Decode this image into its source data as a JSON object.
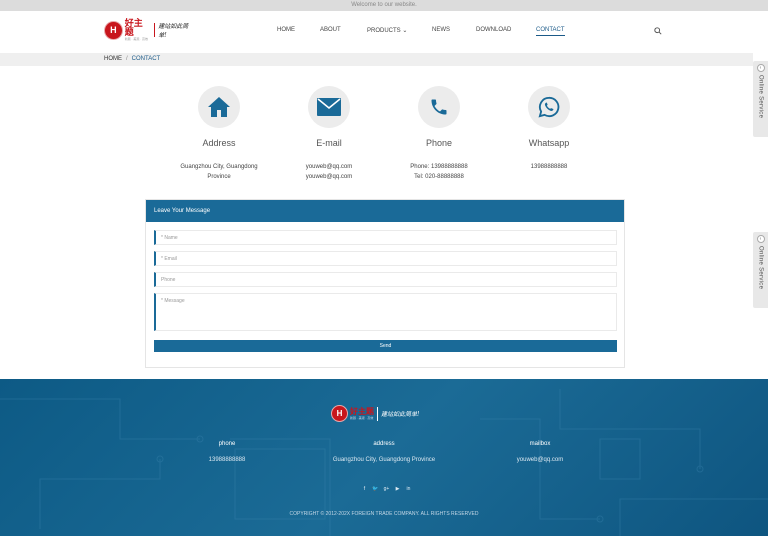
{
  "topbar": {
    "welcome": "Welcome to our website."
  },
  "logo": {
    "mark": "H",
    "brand": "好主题",
    "sub": "新颖 · 美观 · 高效",
    "slogan": "建站如此简单!"
  },
  "nav": {
    "items": [
      {
        "label": "HOME",
        "active": false
      },
      {
        "label": "ABOUT",
        "active": false
      },
      {
        "label": "PRODUCTS",
        "active": false,
        "has_dropdown": true
      },
      {
        "label": "NEWS",
        "active": false
      },
      {
        "label": "DOWNLOAD",
        "active": false
      },
      {
        "label": "CONTACT",
        "active": true
      }
    ],
    "dropdown_glyph": "⌄"
  },
  "breadcrumb": {
    "home": "HOME",
    "separator": "/",
    "current": "CONTACT"
  },
  "cards": [
    {
      "icon": "house-icon",
      "title": "Address",
      "lines": [
        "Guangzhou City, Guangdong",
        "Province"
      ]
    },
    {
      "icon": "envelope-icon",
      "title": "E-mail",
      "lines": [
        "youweb@qq.com",
        "youweb@qq.com"
      ]
    },
    {
      "icon": "phone-icon",
      "title": "Phone",
      "lines": [
        "Phone: 13988888888",
        "Tel: 020-88888888"
      ]
    },
    {
      "icon": "whatsapp-icon",
      "title": "Whatsapp",
      "lines": [
        "13988888888"
      ]
    }
  ],
  "message_form": {
    "title": "Leave Your Message",
    "fields": {
      "name": "* Name",
      "email": "* Email",
      "phone": "Phone",
      "message": "* Message"
    },
    "send_label": "Send"
  },
  "footer": {
    "columns": [
      {
        "label": "phone",
        "value": "13988888888"
      },
      {
        "label": "address",
        "value": "Guangzhou City, Guangdong Province"
      },
      {
        "label": "mailbox",
        "value": "youweb@qq.com"
      }
    ],
    "social": [
      {
        "icon": "facebook-icon",
        "glyph": "f"
      },
      {
        "icon": "twitter-icon",
        "glyph": "🐦"
      },
      {
        "icon": "google-plus-icon",
        "glyph": "g+"
      },
      {
        "icon": "youtube-icon",
        "glyph": "▶"
      },
      {
        "icon": "linkedin-icon",
        "glyph": "in"
      }
    ],
    "copyright": "COPYRIGHT © 2012-202X FOREIGN TRADE COMPANY. ALL RIGHTS RESERVED"
  },
  "online_service": {
    "label": "Online Service",
    "chevron": "‹"
  },
  "colors": {
    "primary": "#1a6a98",
    "logo_red": "#c8161d",
    "footer_bg": "#0d5a85"
  }
}
